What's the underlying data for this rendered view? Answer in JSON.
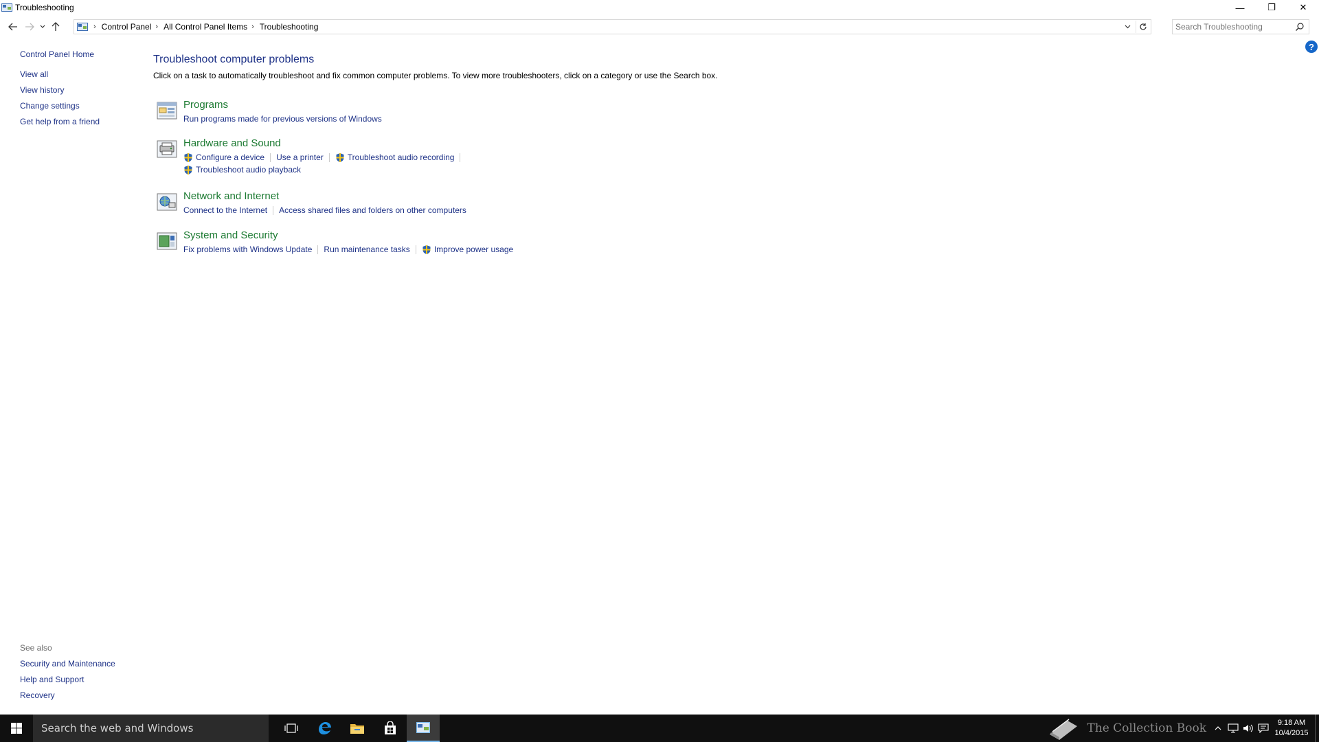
{
  "window": {
    "title": "Troubleshooting",
    "minimize": "—",
    "restore": "❐",
    "close": "✕"
  },
  "address": {
    "breadcrumbs": [
      "Control Panel",
      "All Control Panel Items",
      "Troubleshooting"
    ],
    "search_placeholder": "Search Troubleshooting"
  },
  "left_pane": {
    "home": "Control Panel Home",
    "links": [
      "View all",
      "View history",
      "Change settings",
      "Get help from a friend"
    ]
  },
  "see_also": {
    "title": "See also",
    "links": [
      "Security and Maintenance",
      "Help and Support",
      "Recovery"
    ]
  },
  "main": {
    "title": "Troubleshoot computer problems",
    "description": "Click on a task to automatically troubleshoot and fix common computer problems. To view more troubleshooters, click on a category or use the Search box.",
    "categories": [
      {
        "title": "Programs",
        "icon": "programs-icon",
        "rows": [
          [
            {
              "label": "Run programs made for previous versions of Windows",
              "shield": false
            }
          ]
        ]
      },
      {
        "title": "Hardware and Sound",
        "icon": "hardware-sound-icon",
        "rows": [
          [
            {
              "label": "Configure a device",
              "shield": true
            },
            {
              "label": "Use a printer",
              "shield": false
            },
            {
              "label": "Troubleshoot audio recording",
              "shield": true
            }
          ],
          [
            {
              "label": "Troubleshoot audio playback",
              "shield": true
            }
          ]
        ]
      },
      {
        "title": "Network and Internet",
        "icon": "network-internet-icon",
        "rows": [
          [
            {
              "label": "Connect to the Internet",
              "shield": false
            },
            {
              "label": "Access shared files and folders on other computers",
              "shield": false
            }
          ]
        ]
      },
      {
        "title": "System and Security",
        "icon": "system-security-icon",
        "rows": [
          [
            {
              "label": "Fix problems with Windows Update",
              "shield": false
            },
            {
              "label": "Run maintenance tasks",
              "shield": false
            },
            {
              "label": "Improve power usage",
              "shield": true
            }
          ]
        ]
      }
    ]
  },
  "taskbar": {
    "search_text": "Search the web and Windows",
    "watermark": "The Collection Book",
    "time": "9:18 AM",
    "date": "10/4/2015"
  },
  "colors": {
    "link_blue": "#1e3287",
    "category_green": "#1c7a32",
    "taskbar_bg": "#101010"
  }
}
